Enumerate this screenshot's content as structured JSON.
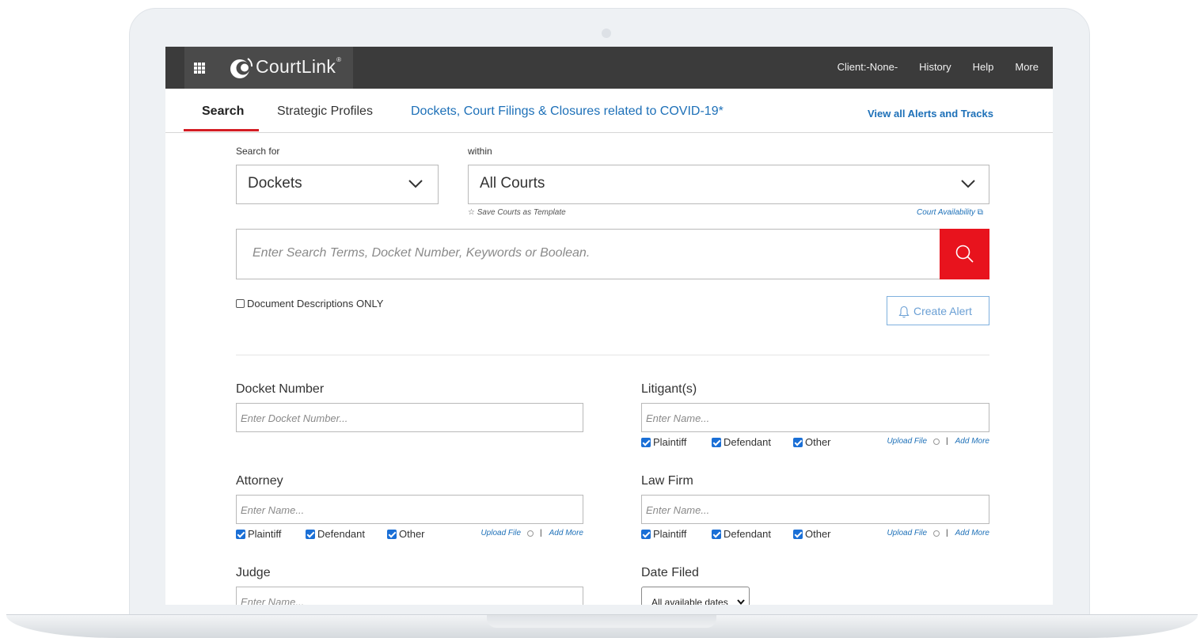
{
  "header": {
    "brand": "CourtLink",
    "brand_mark": "®",
    "nav": [
      "Client:-None-",
      "History",
      "Help",
      "More"
    ]
  },
  "tabs": {
    "search": "Search",
    "strategic_profiles": "Strategic Profiles",
    "covid": "Dockets, Court Filings & Closures related to COVID-19*",
    "alerts_link": "View all Alerts and Tracks"
  },
  "search": {
    "search_for_label": "Search for",
    "search_for_value": "Dockets",
    "within_label": "within",
    "within_value": "All Courts",
    "save_template": "Save Courts as Template",
    "court_availability": "Court Availability",
    "placeholder": "Enter Search Terms, Docket Number, Keywords or Boolean.",
    "doc_desc_only": "Document Descriptions ONLY",
    "create_alert": "Create Alert"
  },
  "fields": {
    "docket_number": {
      "label": "Docket Number",
      "placeholder": "Enter Docket Number..."
    },
    "litigants": {
      "label": "Litigant(s)",
      "placeholder": "Enter Name..."
    },
    "attorney": {
      "label": "Attorney",
      "placeholder": "Enter Name..."
    },
    "law_firm": {
      "label": "Law Firm",
      "placeholder": "Enter Name..."
    },
    "judge": {
      "label": "Judge",
      "placeholder": "Enter Name..."
    },
    "date_filed": {
      "label": "Date Filed",
      "value": "All available dates"
    }
  },
  "party_options": {
    "plaintiff": "Plaintiff",
    "defendant": "Defendant",
    "other": "Other",
    "upload_file": "Upload File",
    "separator": "|",
    "add_more": "Add More"
  },
  "colors": {
    "topbar": "#3b3b3b",
    "accent_red": "#e8131d",
    "link_blue": "#1d70b8",
    "checkbox_blue": "#1a6fd6"
  }
}
